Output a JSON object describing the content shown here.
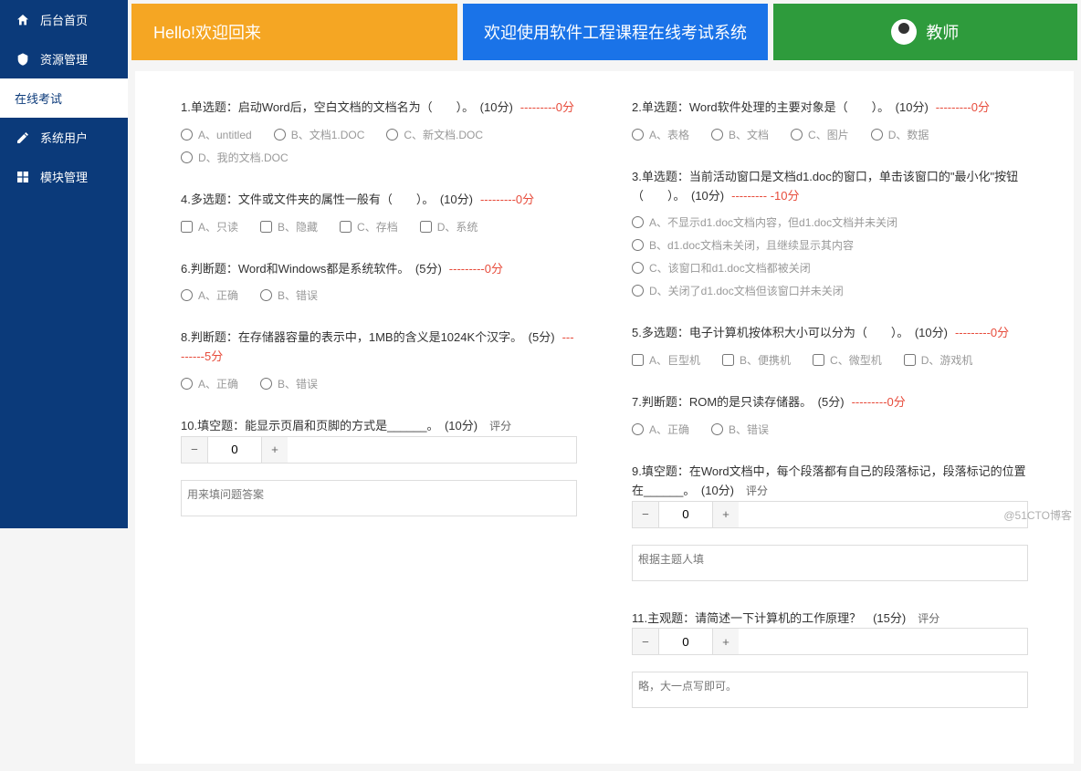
{
  "sidebar": {
    "items": [
      {
        "icon": "home",
        "label": "后台首页"
      },
      {
        "icon": "shield",
        "label": "资源管理"
      },
      {
        "icon": "",
        "label": "在线考试"
      },
      {
        "icon": "edit",
        "label": "系统用户"
      },
      {
        "icon": "grid",
        "label": "模块管理"
      }
    ]
  },
  "banners": {
    "b1": "Hello!欢迎回来",
    "b2": "欢迎使用软件工程课程在线考试系统",
    "b3": "教师"
  },
  "questions_left": [
    {
      "no": "1",
      "type": "单选题",
      "text": "启动Word后，空白文档的文档名为（　　）。",
      "points": "(10分)",
      "score": "---------0分",
      "opts": [
        "A、untitled",
        "B、文档1.DOC",
        "C、新文档.DOC",
        "D、我的文档.DOC"
      ],
      "input": "radio"
    },
    {
      "no": "4",
      "type": "多选题",
      "text": "文件或文件夹的属性一般有（　　）。",
      "points": "(10分)",
      "score": "---------0分",
      "opts": [
        "A、只读",
        "B、隐藏",
        "C、存档",
        "D、系统"
      ],
      "input": "checkbox"
    },
    {
      "no": "6",
      "type": "判断题",
      "text": "Word和Windows都是系统软件。",
      "points": "(5分)",
      "score": "---------0分",
      "opts": [
        "A、正确",
        "B、错误"
      ],
      "input": "radio"
    },
    {
      "no": "8",
      "type": "判断题",
      "text": "在存储器容量的表示中，1MB的含义是1024K个汉字。",
      "points": "(5分)",
      "score": "---------5分",
      "opts": [
        "A、正确",
        "B、错误"
      ],
      "input": "radio"
    },
    {
      "no": "10",
      "type": "填空题",
      "text": "能显示页眉和页脚的方式是______。",
      "points": "(10分)",
      "score": "",
      "fill": true,
      "fill_label": "评分",
      "fill_value": "0",
      "placeholder": "用来填问题答案"
    }
  ],
  "questions_right": [
    {
      "no": "2",
      "type": "单选题",
      "text": "Word软件处理的主要对象是（　　）。",
      "points": "(10分)",
      "score": "---------0分",
      "opts": [
        "A、表格",
        "B、文档",
        "C、图片",
        "D、数据"
      ],
      "input": "radio"
    },
    {
      "no": "3",
      "type": "单选题",
      "text": "当前活动窗口是文档d1.doc的窗口，单击该窗口的\"最小化\"按钮（　　）。",
      "points": "(10分)",
      "score": "--------- -10分",
      "opts": [
        "A、不显示d1.doc文档内容，但d1.doc文档并未关闭",
        "B、d1.doc文档未关闭，且继续显示其内容",
        "C、该窗口和d1.doc文档都被关闭",
        "D、关闭了d1.doc文档但该窗口并未关闭"
      ],
      "input": "radio",
      "vertical": true
    },
    {
      "no": "5",
      "type": "多选题",
      "text": "电子计算机按体积大小可以分为（　　）。",
      "points": "(10分)",
      "score": "---------0分",
      "opts": [
        "A、巨型机",
        "B、便携机",
        "C、微型机",
        "D、游戏机"
      ],
      "input": "checkbox"
    },
    {
      "no": "7",
      "type": "判断题",
      "text": "ROM的是只读存储器。",
      "points": "(5分)",
      "score": "---------0分",
      "opts": [
        "A、正确",
        "B、错误"
      ],
      "input": "radio"
    },
    {
      "no": "9",
      "type": "填空题",
      "text": "在Word文档中，每个段落都有自己的段落标记，段落标记的位置在______。",
      "points": "(10分)",
      "score": "",
      "fill": true,
      "fill_label": "评分",
      "fill_value": "0",
      "placeholder": "根据主题人填"
    },
    {
      "no": "11",
      "type": "主观题",
      "text": "请简述一下计算机的工作原理？",
      "points": "(15分)",
      "score": "",
      "fill": true,
      "fill_label": "评分",
      "fill_value": "0",
      "placeholder": "略，大一点写即可。"
    }
  ],
  "watermark": "@51CTO博客"
}
